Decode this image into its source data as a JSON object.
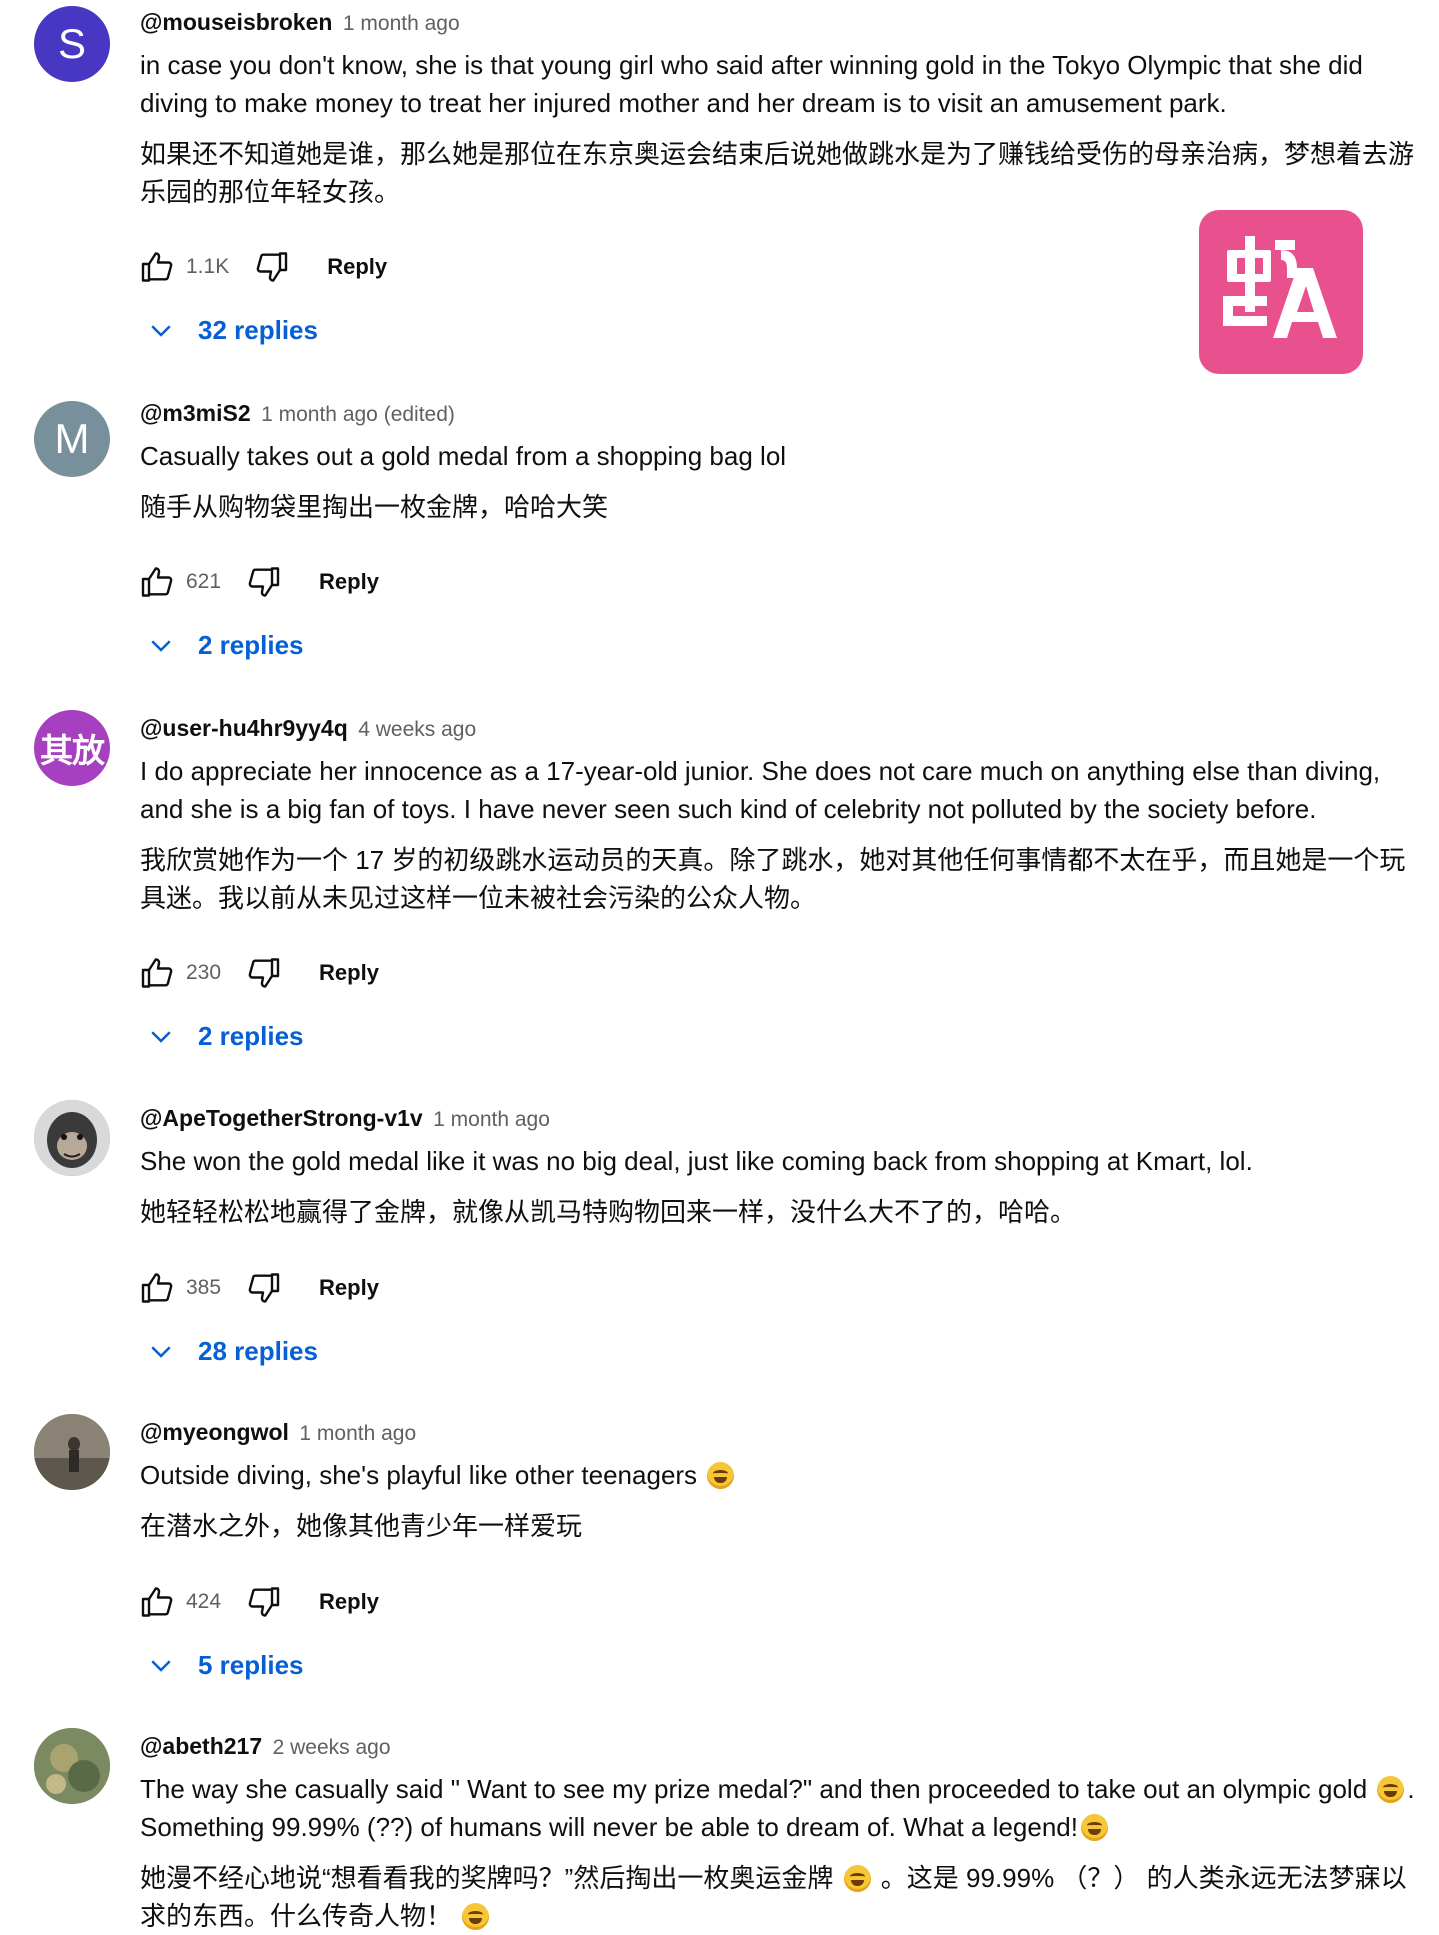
{
  "translate_badge": {
    "icon": "translate-zh-a-icon",
    "color": "#e9508e"
  },
  "comments": [
    {
      "author": "@mouseisbroken",
      "time": "1 month ago",
      "avatar": {
        "letter": "S",
        "color": "#4737c3"
      },
      "text": "in case you don't know, she is that young girl who said after winning gold in the Tokyo Olympic that she did diving to make money to treat her injured mother and her dream is to visit an amusement park.",
      "translation": "如果还不知道她是谁，那么她是那位在东京奥运会结束后说她做跳水是为了赚钱给受伤的母亲治病，梦想着去游乐园的那位年轻女孩。",
      "likes": "1.1K",
      "reply_label": "Reply",
      "replies_label": "32 replies"
    },
    {
      "author": "@m3miS2",
      "time": "1 month ago (edited)",
      "avatar": {
        "letter": "M",
        "color": "#78909c"
      },
      "text": "Casually takes out a gold medal from a shopping bag lol",
      "translation": "随手从购物袋里掏出一枚金牌，哈哈大笑",
      "likes": "621",
      "reply_label": "Reply",
      "replies_label": "2 replies"
    },
    {
      "author": "@user-hu4hr9yy4q",
      "time": "4 weeks ago",
      "avatar": {
        "letter": "其放",
        "color": "#a63fc0"
      },
      "text": "I do appreciate her innocence as a 17-year-old junior. She does not care much on anything else than diving, and she is a big fan of toys. I have never seen such kind of celebrity not polluted by the society before.",
      "translation": "我欣赏她作为一个 17 岁的初级跳水运动员的天真。除了跳水，她对其他任何事情都不太在乎，而且她是一个玩具迷。我以前从未见过这样一位未被社会污染的公众人物。",
      "likes": "230",
      "reply_label": "Reply",
      "replies_label": "2 replies"
    },
    {
      "author": "@ApeTogetherStrong-v1v",
      "time": "1 month ago",
      "avatar": {
        "letter": "",
        "color": "#8c8c8c"
      },
      "text": "She won the gold medal like it was no big deal, just like coming back from shopping at Kmart, lol.",
      "translation": "她轻轻松松地赢得了金牌，就像从凯马特购物回来一样，没什么大不了的，哈哈。",
      "likes": "385",
      "reply_label": "Reply",
      "replies_label": "28 replies"
    },
    {
      "author": "@myeongwol",
      "time": "1 month ago",
      "avatar": {
        "letter": "",
        "color": "#6e6a60"
      },
      "text": "Outside diving, she's playful like other teenagers",
      "translation": "在潜水之外，她像其他青少年一样爱玩",
      "likes": "424",
      "reply_label": "Reply",
      "replies_label": "5 replies"
    },
    {
      "author": "@abeth217",
      "time": "2 weeks ago",
      "avatar": {
        "letter": "",
        "color": "#7c8a62"
      },
      "text": "The way she casually said \" Want to see my prize medal?\" and then proceeded to take out an olympic gold",
      "text2": ". Something 99.99% (??) of humans will never be able to dream of. What a legend!",
      "translation": "她漫不经心地说“想看看我的奖牌吗？”然后掏出一枚奥运金牌",
      "translation2": "。这是 99.99% （？） 的人类永远无法梦寐以求的东西。什么传奇人物！"
    }
  ]
}
